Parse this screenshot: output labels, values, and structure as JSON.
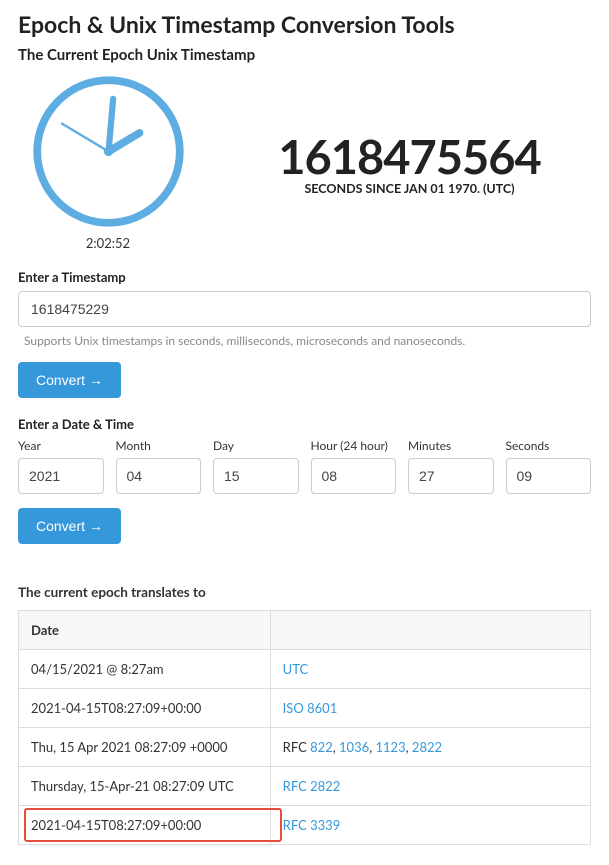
{
  "title": "Epoch & Unix Timestamp Conversion Tools",
  "subtitle": "The Current Epoch Unix Timestamp",
  "clock": {
    "time_text": "2:02:52"
  },
  "current": {
    "timestamp": "1618475564",
    "caption": "SECONDS SINCE JAN 01 1970. (UTC)"
  },
  "ts_section": {
    "label": "Enter a Timestamp",
    "value": "1618475229",
    "hint": "Supports Unix timestamps in seconds, milliseconds, microseconds and nanoseconds.",
    "button": "Convert →"
  },
  "dt_section": {
    "label": "Enter a Date & Time",
    "cols": {
      "year": {
        "label": "Year",
        "value": "2021"
      },
      "month": {
        "label": "Month",
        "value": "04"
      },
      "day": {
        "label": "Day",
        "value": "15"
      },
      "hour": {
        "label": "Hour (24 hour)",
        "value": "08"
      },
      "minutes": {
        "label": "Minutes",
        "value": "27"
      },
      "seconds": {
        "label": "Seconds",
        "value": "09"
      }
    },
    "button": "Convert →"
  },
  "translate": {
    "title": "The current epoch translates to",
    "header": {
      "col1": "Date",
      "col2": ""
    },
    "rows": [
      {
        "date": "04/15/2021 @ 8:27am",
        "fmt_parts": [
          {
            "text": "UTC",
            "link": true
          }
        ]
      },
      {
        "date": "2021-04-15T08:27:09+00:00",
        "fmt_parts": [
          {
            "text": "ISO 8601",
            "link": true
          }
        ]
      },
      {
        "date": "Thu, 15 Apr 2021 08:27:09 +0000",
        "fmt_parts": [
          {
            "text": "RFC ",
            "link": false
          },
          {
            "text": "822",
            "link": true
          },
          {
            "text": ", ",
            "link": false
          },
          {
            "text": "1036",
            "link": true
          },
          {
            "text": ", ",
            "link": false
          },
          {
            "text": "1123",
            "link": true
          },
          {
            "text": ", ",
            "link": false
          },
          {
            "text": "2822",
            "link": true
          }
        ]
      },
      {
        "date": "Thursday, 15-Apr-21 08:27:09 UTC",
        "fmt_parts": [
          {
            "text": "RFC 2822",
            "link": true
          }
        ]
      },
      {
        "date": "2021-04-15T08:27:09+00:00",
        "highlight": true,
        "fmt_parts": [
          {
            "text": "RFC 3339",
            "link": true
          }
        ]
      }
    ]
  }
}
